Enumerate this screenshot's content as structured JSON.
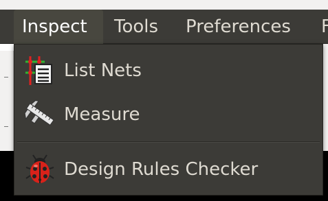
{
  "menubar": {
    "items": [
      {
        "label": "Inspect"
      },
      {
        "label": "Tools"
      },
      {
        "label": "Preferences"
      },
      {
        "label": "F"
      }
    ]
  },
  "dropdown": {
    "items": [
      {
        "label": "List Nets",
        "icon": "list-nets-icon"
      },
      {
        "label": "Measure",
        "icon": "caliper-icon"
      },
      {
        "label": "Design Rules Checker",
        "icon": "ladybug-icon"
      }
    ]
  },
  "colors": {
    "menubar_bg": "#3c3b37",
    "active_menu_bg": "#48473f",
    "menu_text": "#dfdbd2",
    "canvas_bg": "#000000"
  }
}
